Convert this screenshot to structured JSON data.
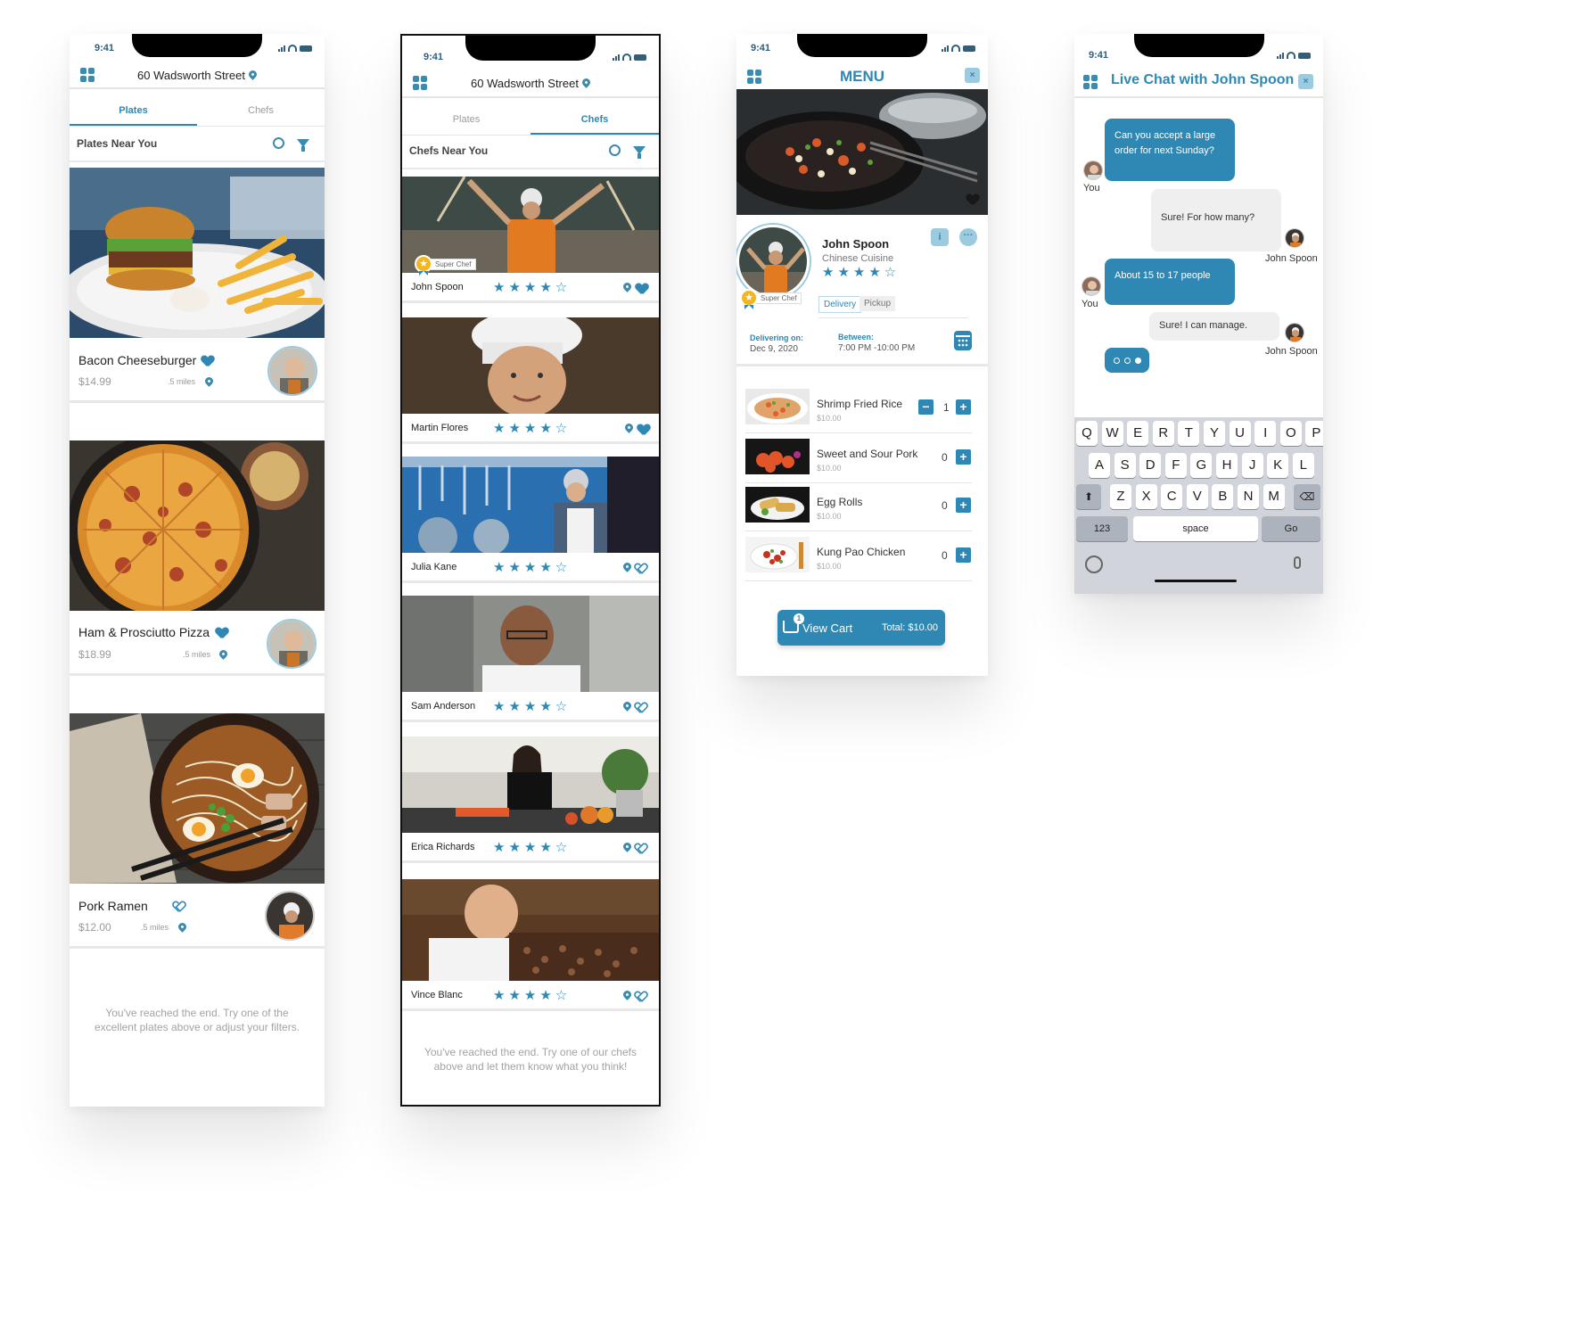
{
  "colors": {
    "accent": "#2e88b3",
    "accent_light": "#9ccbe0",
    "muted": "#9a9a9a"
  },
  "status": {
    "time": "9:41"
  },
  "plates_screen": {
    "address": "60 Wadsworth Street",
    "tabs": [
      "Plates",
      "Chefs"
    ],
    "active_tab": "Plates",
    "filter_label": "Plates Near You",
    "plates": [
      {
        "name": "Bacon Cheeseburger",
        "price": "$14.99",
        "distance": ".5 miles",
        "favorite": true
      },
      {
        "name": "Ham & Prosciutto Pizza",
        "price": "$18.99",
        "distance": ".5 miles",
        "favorite": true
      },
      {
        "name": "Pork Ramen",
        "price": "$12.00",
        "distance": ".5 miles",
        "favorite": false
      }
    ],
    "end_message": "You've reached the end. Try one of the excellent plates above or adjust your filters."
  },
  "chefs_screen": {
    "address": "60 Wadsworth Street",
    "tabs": [
      "Plates",
      "Chefs"
    ],
    "active_tab": "Chefs",
    "filter_label": "Chefs Near You",
    "super_chef_label": "Super Chef",
    "chefs": [
      {
        "name": "John Spoon",
        "rating": 4,
        "favorite": true,
        "super_chef": true
      },
      {
        "name": "Martin Flores",
        "rating": 4,
        "favorite": true,
        "super_chef": false
      },
      {
        "name": "Julia Kane",
        "rating": 4,
        "favorite": false,
        "super_chef": false
      },
      {
        "name": "Sam Anderson",
        "rating": 4,
        "favorite": false,
        "super_chef": false
      },
      {
        "name": "Erica Richards",
        "rating": 4,
        "favorite": false,
        "super_chef": false
      },
      {
        "name": "Vince  Blanc",
        "rating": 4,
        "favorite": false,
        "super_chef": false
      }
    ],
    "end_message": "You've reached the end. Try one of our chefs above and let them know what you think!"
  },
  "menu_screen": {
    "title": "MENU",
    "close": "×",
    "chef": {
      "name": "John Spoon",
      "cuisine": "Chinese Cuisine",
      "rating": 4,
      "badge": "Super Chef"
    },
    "modes": [
      "Delivery",
      "Pickup"
    ],
    "delivering_label": "Delivering on:",
    "delivering_date": "Dec 9, 2020",
    "between_label": "Between:",
    "between_value": "7:00 PM -10:00 PM",
    "items": [
      {
        "name": "Shrimp Fried Rice",
        "price": "$10.00",
        "qty": "1",
        "show_minus": true
      },
      {
        "name": "Sweet and Sour Pork",
        "price": "$10.00",
        "qty": "0",
        "show_minus": false
      },
      {
        "name": "Egg Rolls",
        "price": "$10.00",
        "qty": "0",
        "show_minus": false
      },
      {
        "name": "Kung Pao Chicken",
        "price": "$10.00",
        "qty": "0",
        "show_minus": false
      }
    ],
    "cart": {
      "label": "View Cart",
      "total": "Total: $10.00",
      "count": "1"
    }
  },
  "chat_screen": {
    "title": "Live Chat with John Spoon",
    "close": "×",
    "messages": [
      {
        "from": "me",
        "who": "You",
        "text": "Can you accept a large order for next Sunday?"
      },
      {
        "from": "them",
        "who": "John Spoon",
        "text": "Sure! For how many?"
      },
      {
        "from": "me",
        "who": "You",
        "text": "About 15 to 17 people"
      },
      {
        "from": "them",
        "who": "John Spoon",
        "text": "Sure! I can manage."
      }
    ],
    "keyboard": {
      "row1": [
        "Q",
        "W",
        "E",
        "R",
        "T",
        "Y",
        "U",
        "I",
        "O",
        "P"
      ],
      "row2": [
        "A",
        "S",
        "D",
        "F",
        "G",
        "H",
        "J",
        "K",
        "L"
      ],
      "row3": [
        "Z",
        "X",
        "C",
        "V",
        "B",
        "N",
        "M"
      ],
      "num_key": "123",
      "space_key": "space",
      "go_key": "Go"
    }
  }
}
